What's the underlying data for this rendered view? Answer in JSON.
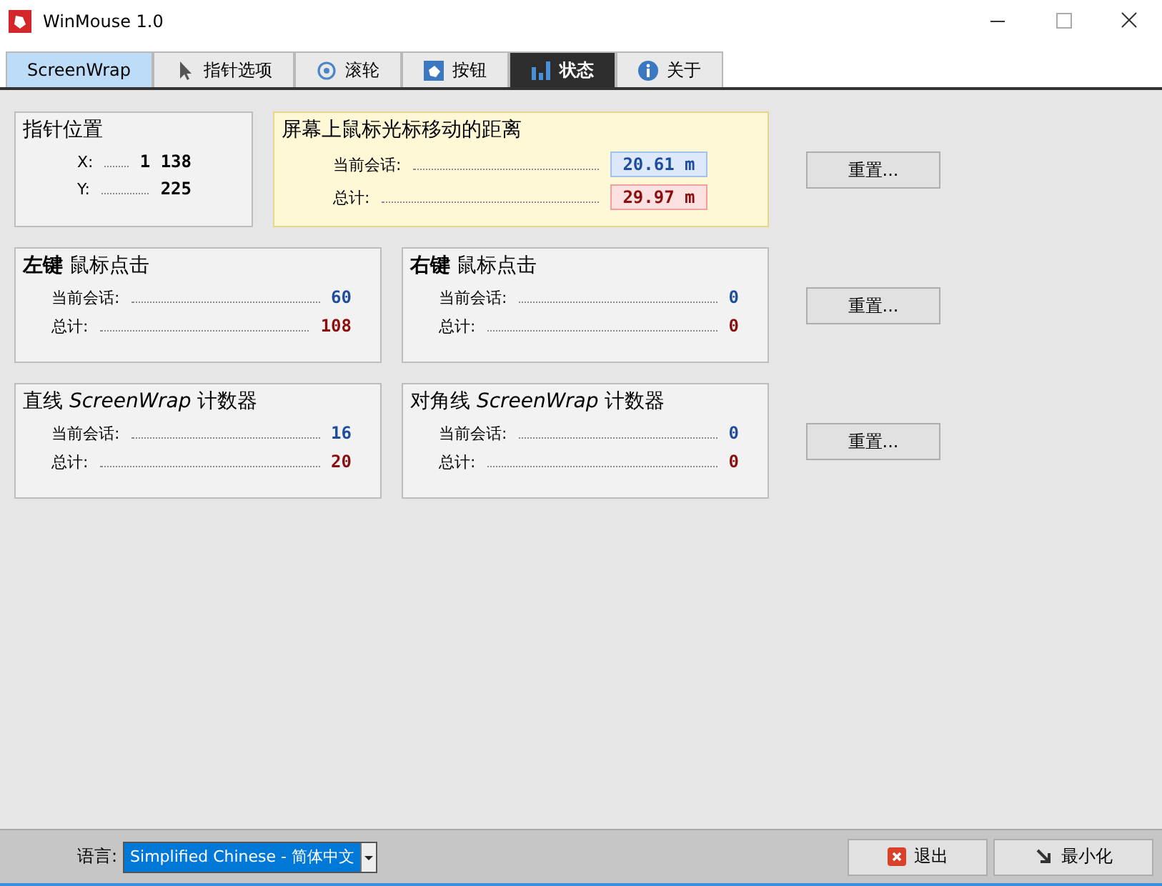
{
  "window": {
    "title": "WinMouse 1.0"
  },
  "tabs": [
    {
      "label": "ScreenWrap",
      "kind": "plain",
      "selected": false,
      "highlighted": true
    },
    {
      "label": "指针选项",
      "kind": "cursor",
      "selected": false,
      "highlighted": false
    },
    {
      "label": "滚轮",
      "kind": "wheel",
      "selected": false,
      "highlighted": false
    },
    {
      "label": "按钮",
      "kind": "button",
      "selected": false,
      "highlighted": false
    },
    {
      "label": "状态",
      "kind": "chart",
      "selected": true,
      "highlighted": false
    },
    {
      "label": "关于",
      "kind": "info",
      "selected": false,
      "highlighted": false
    }
  ],
  "rows": [
    {
      "panels": [
        {
          "kind": "position",
          "title": "指针位置",
          "lines": [
            {
              "label": "X:",
              "value": "1 138",
              "kind": "plain"
            },
            {
              "label": "Y:",
              "value": "225",
              "kind": "plain"
            }
          ]
        },
        {
          "kind": "distance",
          "title": "屏幕上鼠标光标移动的距离",
          "lines": [
            {
              "label": "当前会话:",
              "value": "20.61 m",
              "kind": "session"
            },
            {
              "label": "总计:",
              "value": "29.97 m",
              "kind": "total"
            }
          ]
        }
      ],
      "reset": "重置..."
    },
    {
      "panels": [
        {
          "kind": "counter",
          "title": "**左键** 鼠标点击",
          "lines": [
            {
              "label": "当前会话:",
              "value": "60",
              "kind": "session"
            },
            {
              "label": "总计:",
              "value": "108",
              "kind": "total"
            }
          ]
        },
        {
          "kind": "counter",
          "title": "**右键** 鼠标点击",
          "lines": [
            {
              "label": "当前会话:",
              "value": "0",
              "kind": "session"
            },
            {
              "label": "总计:",
              "value": "0",
              "kind": "total"
            }
          ]
        }
      ],
      "reset": "重置..."
    },
    {
      "panels": [
        {
          "kind": "counter",
          "title": "直线 *ScreenWrap* 计数器",
          "lines": [
            {
              "label": "当前会话:",
              "value": "16",
              "kind": "session"
            },
            {
              "label": "总计:",
              "value": "20",
              "kind": "total"
            }
          ]
        },
        {
          "kind": "counter",
          "title": "对角线 *ScreenWrap* 计数器",
          "lines": [
            {
              "label": "当前会话:",
              "value": "0",
              "kind": "session"
            },
            {
              "label": "总计:",
              "value": "0",
              "kind": "total"
            }
          ]
        }
      ],
      "reset": "重置..."
    }
  ],
  "footer": {
    "language_label": "语言:",
    "language_value": "Simplified Chinese  -  简体中文",
    "buttons": [
      {
        "label": "退出",
        "kind": "exit"
      },
      {
        "label": "最小化",
        "kind": "minimize"
      }
    ]
  }
}
